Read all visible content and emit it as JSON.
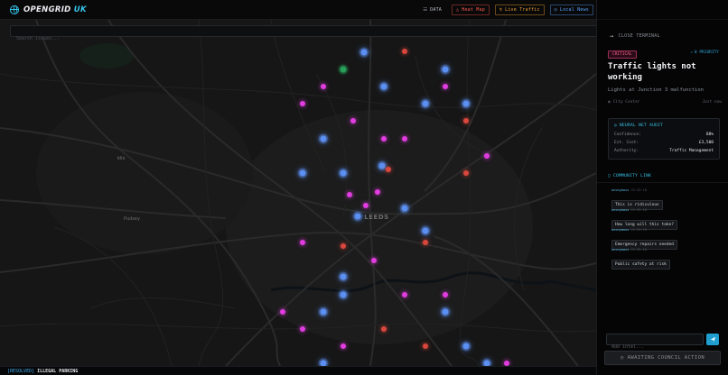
{
  "header": {
    "brand_main": "OPENGRID",
    "brand_accent": "UK",
    "nav": [
      {
        "label": "DATA",
        "icon": "chart-icon"
      },
      {
        "label": "Heat Map",
        "icon": "flame-icon"
      },
      {
        "label": "Live Traffic",
        "icon": "bolt-icon"
      },
      {
        "label": "Local News",
        "icon": "globe-icon"
      }
    ]
  },
  "search": {
    "placeholder": "Search issues..."
  },
  "map": {
    "city_label": "LEEDS",
    "place_labels": [
      "Idle",
      "Pudsey"
    ]
  },
  "ticker": {
    "tag": "[RESOLVED]",
    "text": "ILLEGAL PARKING"
  },
  "panel": {
    "close_label": "CLOSE TERMINAL",
    "severity": "CRITICAL",
    "priority": "0 PRIORITY",
    "title": "Traffic lights not working",
    "subtitle": "Lights at Junction 3 malfunction",
    "location": "City Center",
    "time": "Just now",
    "audit": {
      "heading": "NEURAL NET AUDIT",
      "rows": [
        {
          "key": "Confidence:",
          "value": "88%"
        },
        {
          "key": "Est. Cost:",
          "value": "£3,500"
        },
        {
          "key": "Authority:",
          "value": "Traffic Management"
        }
      ]
    },
    "community": {
      "heading": "COMMUNITY LINK",
      "messages": [
        {
          "user": "anonymous",
          "time": "22:25:18",
          "text": "This is ridiculous"
        },
        {
          "user": "anonymous",
          "time": "22:25:18",
          "text": "How long will this take?"
        },
        {
          "user": "anonymous",
          "time": "22:25:18",
          "text": "Emergency repairs needed"
        },
        {
          "user": "anonymous",
          "time": "22:25:18",
          "text": "Public safety at risk"
        }
      ]
    },
    "intel_placeholder": "Add intel...",
    "status_button": "AWAITING COUNCIL ACTION"
  },
  "colors": {
    "accent": "#36c6ea",
    "critical": "#ff5c8e",
    "pin_blue": "#5b8ff2",
    "pin_pink": "#e03ce0",
    "pin_red": "#d9473c",
    "pin_green": "#27a05a"
  }
}
